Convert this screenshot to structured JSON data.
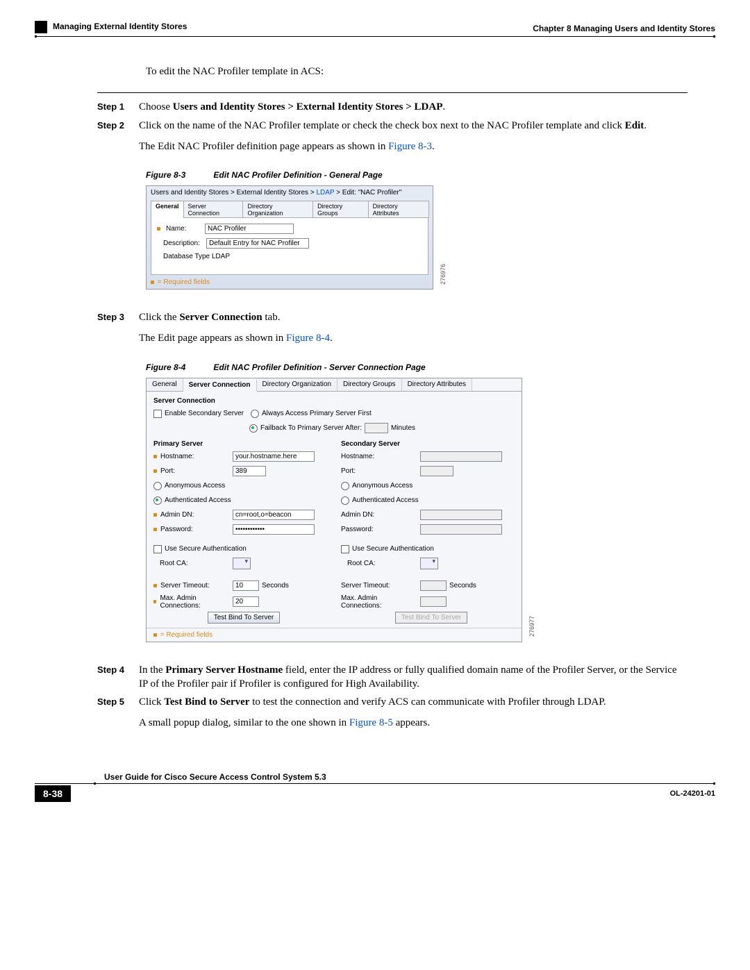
{
  "header": {
    "chapter": "Chapter 8      Managing Users and Identity Stores",
    "section": "Managing External Identity Stores"
  },
  "intro": "To edit the NAC Profiler template in ACS:",
  "steps": {
    "s1": {
      "label": "Step 1",
      "pre": "Choose ",
      "bold": "Users and Identity Stores > External Identity Stores > LDAP",
      "post": "."
    },
    "s2": {
      "label": "Step 2",
      "line1a": "Click on the name of the NAC Profiler template or check the check box next to the NAC Profiler template and click ",
      "line1b": "Edit",
      "line1c": ".",
      "line2a": "The Edit NAC Profiler definition page appears as shown in ",
      "line2b": "Figure 8-3",
      "line2c": "."
    },
    "s3": {
      "label": "Step 3",
      "line1a": "Click the ",
      "line1b": "Server Connection",
      "line1c": " tab.",
      "line2a": "The Edit page appears as shown in ",
      "line2b": "Figure 8-4",
      "line2c": "."
    },
    "s4": {
      "label": "Step 4",
      "a": "In the ",
      "b": "Primary Server Hostname",
      "c": " field, enter the IP address or fully qualified domain name of the Profiler Server, or the Service IP of the Profiler pair if Profiler is configured for High Availability."
    },
    "s5": {
      "label": "Step 5",
      "a": "Click ",
      "b": "Test Bind to Server",
      "c": " to test the connection and verify ACS can communicate with Profiler through LDAP.",
      "d": "A small popup dialog, similar to the one shown in ",
      "e": "Figure 8-5",
      "f": " appears."
    }
  },
  "fig83": {
    "cap_num": "Figure 8-3",
    "cap_title": "Edit NAC Profiler Definition - General Page",
    "crumb_pre": "Users and Identity Stores > External Identity Stores > ",
    "crumb_link": "LDAP",
    "crumb_post": " > Edit: \"NAC Profiler\"",
    "tabs": [
      "General",
      "Server Connection",
      "Directory Organization",
      "Directory Groups",
      "Directory Attributes"
    ],
    "name_label": "Name:",
    "name_val": "NAC Profiler",
    "desc_label": "Description:",
    "desc_val": "Default Entry for NAC Profiler",
    "dbtype": "Database Type LDAP",
    "reqnote": " = Required fields",
    "sidecode": "276976"
  },
  "fig84": {
    "cap_num": "Figure 8-4",
    "cap_title": "Edit NAC Profiler Definition - Server Connection Page",
    "tabs": [
      "General",
      "Server Connection",
      "Directory Organization",
      "Directory Groups",
      "Directory Attributes"
    ],
    "section_title": "Server Connection",
    "enable_secondary": "Enable Secondary Server",
    "always_first": "Always Access Primary Server First",
    "failback": "Failback To Primary Server After:",
    "failback_unit": "Minutes",
    "primary_title": "Primary Server",
    "secondary_title": "Secondary Server",
    "hostname": "Hostname:",
    "hostname_val": "your.hostname.here",
    "port": "Port:",
    "port_val": "389",
    "anon": "Anonymous Access",
    "auth": "Authenticated Access",
    "admindn": "Admin DN:",
    "admindn_val": "cn=root,o=beacon",
    "password": "Password:",
    "password_val": "••••••••••••",
    "secure": "Use Secure Authentication",
    "rootca": "Root CA:",
    "timeout": "Server Timeout:",
    "timeout_val": "10",
    "timeout_unit": "Seconds",
    "maxconn": "Max. Admin Connections:",
    "maxconn_val": "20",
    "testbtn": "Test Bind To Server",
    "reqnote": " = Required fields",
    "sidecode": "276977"
  },
  "footer": {
    "guide": "User Guide for Cisco Secure Access Control System 5.3",
    "pagenum": "8-38",
    "docid": "OL-24201-01"
  }
}
